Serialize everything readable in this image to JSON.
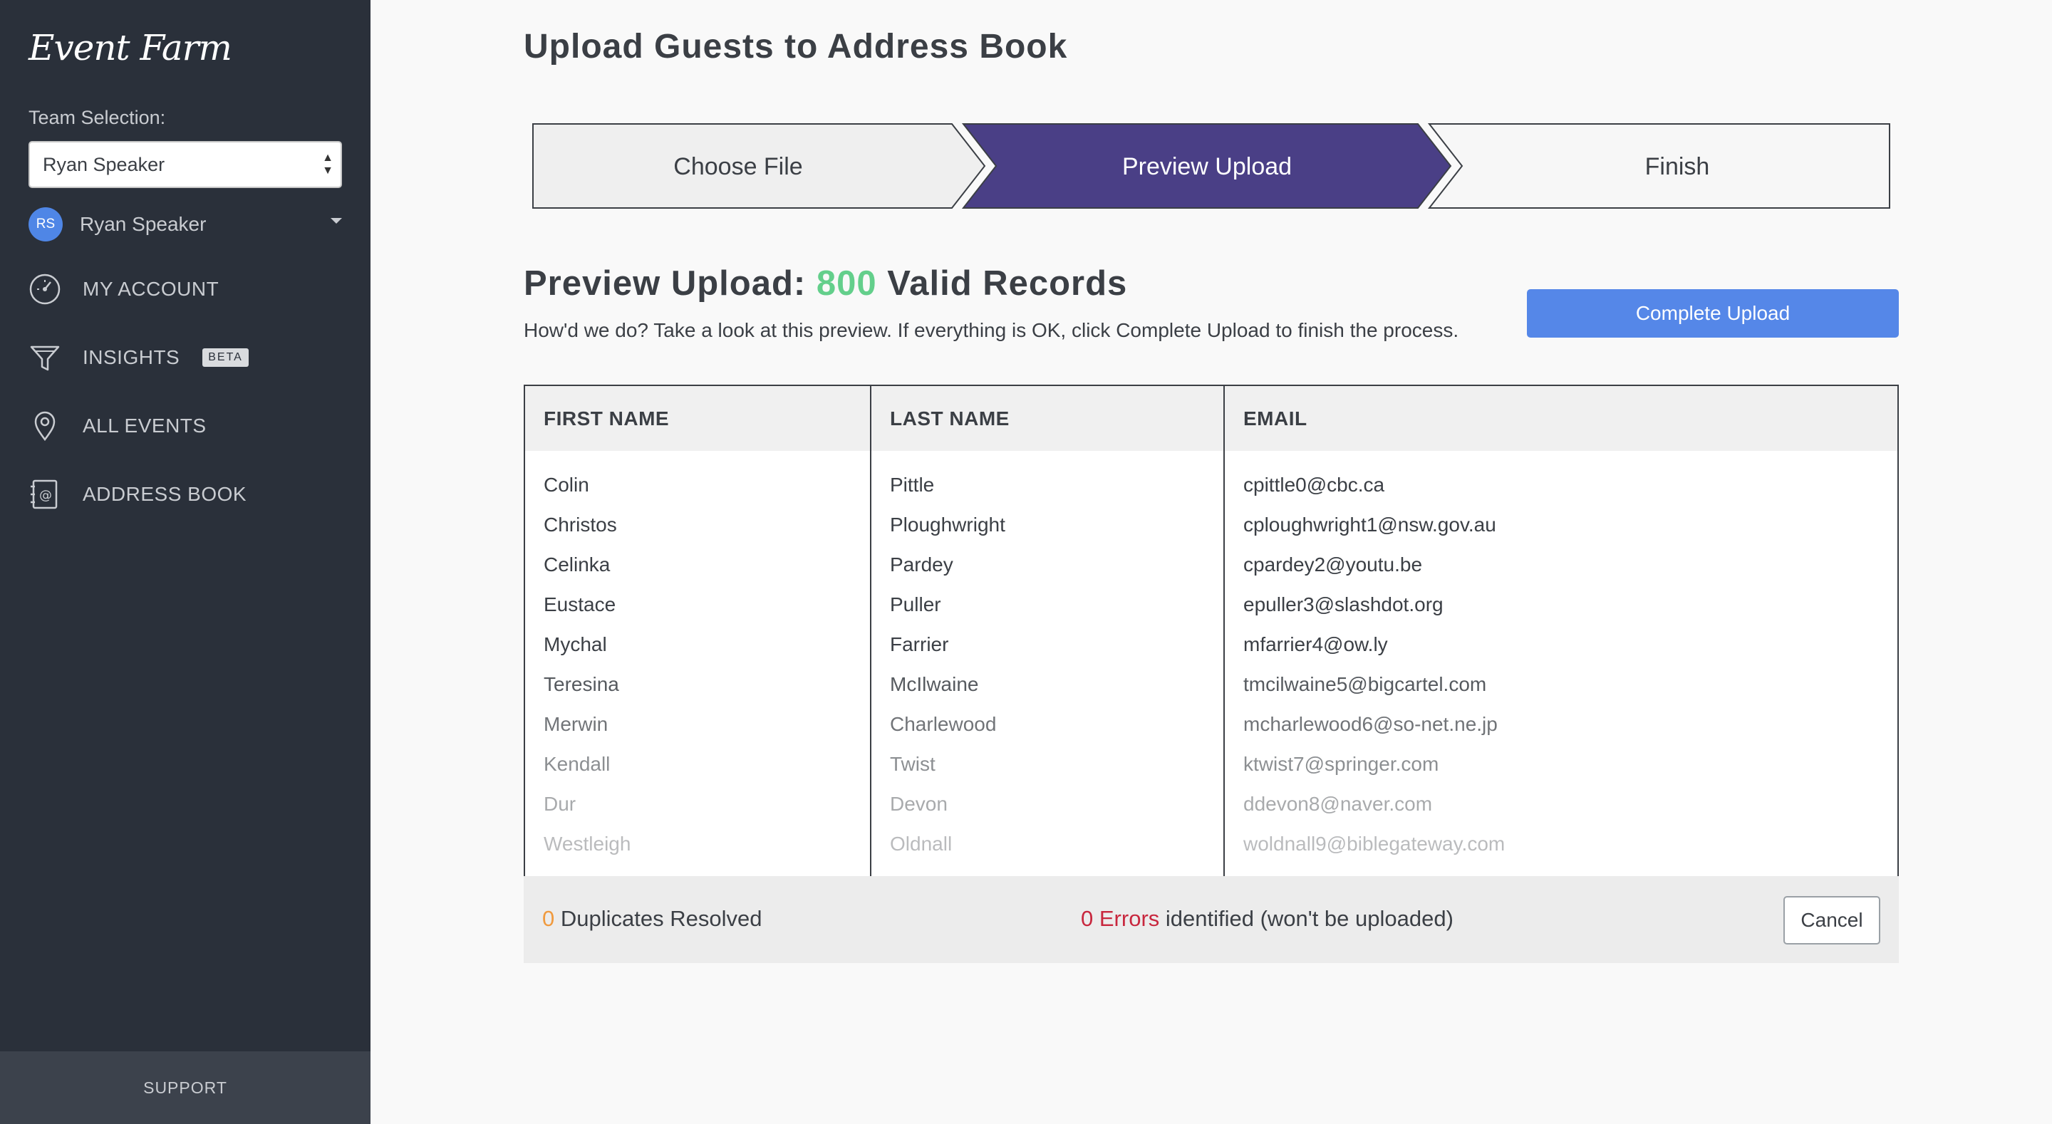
{
  "sidebar": {
    "logo": "Event Farm",
    "team_label": "Team Selection:",
    "team_value": "Ryan Speaker",
    "user": {
      "initials": "RS",
      "name": "Ryan Speaker"
    },
    "nav": [
      {
        "label": "MY ACCOUNT",
        "icon": "dashboard-gauge-icon"
      },
      {
        "label": "INSIGHTS",
        "icon": "funnel-icon",
        "badge": "BETA"
      },
      {
        "label": "ALL EVENTS",
        "icon": "map-pin-icon"
      },
      {
        "label": "ADDRESS BOOK",
        "icon": "address-book-icon"
      }
    ],
    "support": "SUPPORT"
  },
  "page": {
    "title": "Upload Guests to Address Book"
  },
  "stepper": {
    "steps": [
      {
        "label": "Choose File",
        "active": false
      },
      {
        "label": "Preview Upload",
        "active": true
      },
      {
        "label": "Finish",
        "active": false
      }
    ],
    "active_color": "#4a3f86"
  },
  "preview": {
    "heading_prefix": "Preview Upload:",
    "count": "800",
    "heading_suffix": "Valid Records",
    "subtitle": "How'd we do? Take a look at this preview. If everything is OK, click Complete Upload to finish the process.",
    "complete_button": "Complete Upload"
  },
  "table": {
    "headers": [
      "FIRST NAME",
      "LAST NAME",
      "EMAIL"
    ],
    "rows": [
      [
        "Colin",
        "Pittle",
        "cpittle0@cbc.ca"
      ],
      [
        "Christos",
        "Ploughwright",
        "cploughwright1@nsw.gov.au"
      ],
      [
        "Celinka",
        "Pardey",
        "cpardey2@youtu.be"
      ],
      [
        "Eustace",
        "Puller",
        "epuller3@slashdot.org"
      ],
      [
        "Mychal",
        "Farrier",
        "mfarrier4@ow.ly"
      ],
      [
        "Teresina",
        "McIlwaine",
        "tmcilwaine5@bigcartel.com"
      ],
      [
        "Merwin",
        "Charlewood",
        "mcharlewood6@so-net.ne.jp"
      ],
      [
        "Kendall",
        "Twist",
        "ktwist7@springer.com"
      ],
      [
        "Dur",
        "Devon",
        "ddevon8@naver.com"
      ],
      [
        "Westleigh",
        "Oldnall",
        "woldnall9@biblegateway.com"
      ]
    ]
  },
  "footer": {
    "duplicates_count": "0",
    "duplicates_label": "Duplicates Resolved",
    "errors_count": "0",
    "errors_word": "Errors",
    "errors_label": "identified (won't be uploaded)",
    "cancel_button": "Cancel"
  },
  "colors": {
    "sidebar_bg": "#2a303a",
    "accent_blue": "#5587e8",
    "valid_green": "#63cf8b",
    "duplicate_orange": "#f09a3e",
    "error_red": "#c8273e"
  }
}
